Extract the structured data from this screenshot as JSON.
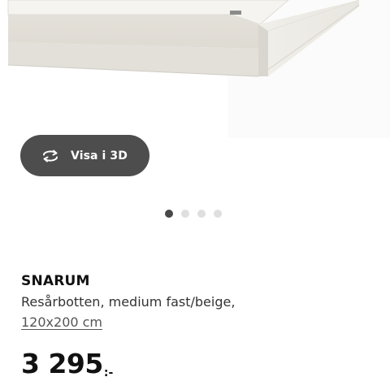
{
  "view_3d_button": {
    "label": "Visa i 3D",
    "icon": "rotate-3d-icon"
  },
  "carousel": {
    "count": 4,
    "active_index": 0
  },
  "product": {
    "name": "SNARUM",
    "description": "Resårbotten, medium fast/beige,",
    "size": "120x200 cm",
    "price": "3 295",
    "price_suffix": ":-"
  },
  "colors": {
    "button_background": "#4d4d4d",
    "dot_active": "#484848",
    "dot_inactive": "#dfdfdf",
    "base_fabric": "#e9e6df"
  }
}
